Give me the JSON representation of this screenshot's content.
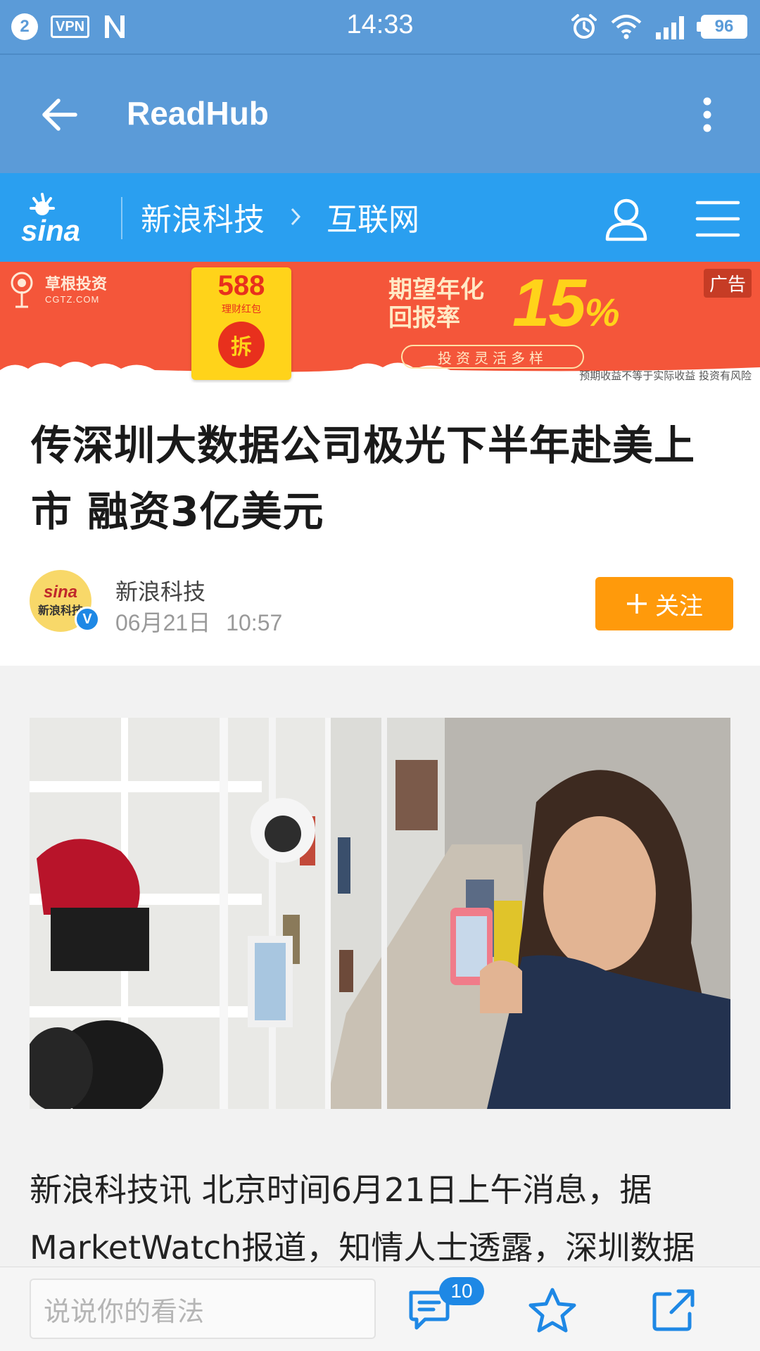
{
  "status_bar": {
    "notification_count": "2",
    "vpn_label": "VPN",
    "time": "14:33",
    "battery": "96"
  },
  "app_bar": {
    "title": "ReadHub"
  },
  "site_nav": {
    "logo_text": "sina",
    "breadcrumb": [
      "新浪科技",
      "互联网"
    ]
  },
  "ad": {
    "brand": "草根投资",
    "brand_domain": "CGTZ.COM",
    "envelope_amount": "588",
    "envelope_label": "理财红包",
    "envelope_seal": "拆",
    "headline_line1": "期望年化",
    "headline_line2": "回报率",
    "rate": "15",
    "rate_unit": "%",
    "pill_text": "投资灵活多样",
    "tag": "广告",
    "disclaimer": "预期收益不等于实际收益 投资有风险"
  },
  "article": {
    "title": "传深圳大数据公司极光下半年赴美上市 融资3亿美元",
    "author": "新浪科技",
    "avatar_text_top": "sina",
    "avatar_text_bottom": "新浪科技",
    "verified_mark": "V",
    "date": "06月21日",
    "time": "10:57",
    "follow_label": "关注",
    "body": "新浪科技讯 北京时间6月21日上午消息，据MarketWatch报道，知情人士透露，深圳数据"
  },
  "bottom_bar": {
    "comment_placeholder": "说说你的看法",
    "comment_count": "10"
  },
  "colors": {
    "status_bar": "#5b9bd8",
    "sina_nav": "#2a9ff0",
    "ad_background": "#f4563a",
    "follow_button": "#ff9a0b",
    "badge": "#1e88e5"
  },
  "icons": [
    "back-arrow-icon",
    "more-vert-icon",
    "sina-logo-icon",
    "chevron-right-icon",
    "user-icon",
    "menu-icon",
    "plus-icon",
    "comment-icon",
    "star-icon",
    "share-icon",
    "alarm-icon",
    "wifi-icon",
    "signal-icon"
  ]
}
